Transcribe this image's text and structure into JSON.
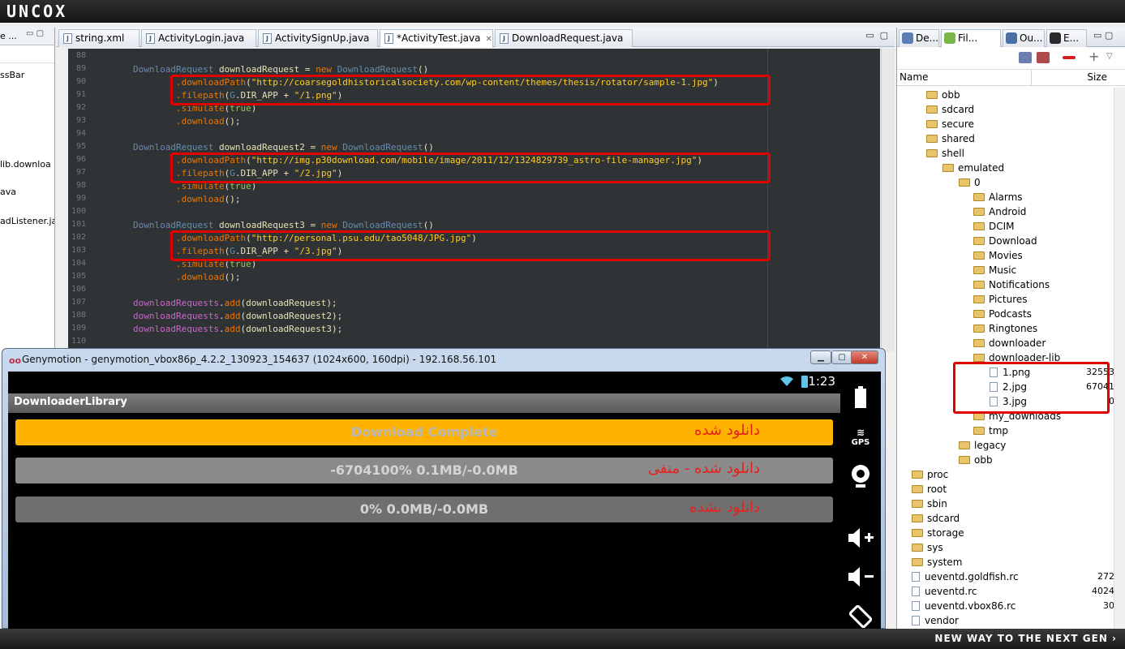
{
  "topbar": {
    "brand": "UNCOX"
  },
  "botbar": {
    "slogan": "NEW WAY TO THE NEXT GEN ›"
  },
  "left_panel": {
    "head_label": "e ...",
    "items": [
      "ssBar",
      "lib.downloa",
      "ava",
      "adListener.jav"
    ]
  },
  "editor": {
    "tabs": [
      {
        "label": "string.xml",
        "active": false
      },
      {
        "label": "ActivityLogin.java",
        "active": false
      },
      {
        "label": "ActivitySignUp.java",
        "active": false
      },
      {
        "label": "*ActivityTest.java",
        "active": true
      },
      {
        "label": "DownloadRequest.java",
        "active": false
      }
    ],
    "line_numbers": [
      "88",
      "89",
      "90",
      "91",
      "92",
      "93",
      "94",
      "95",
      "96",
      "97",
      "98",
      "99",
      "100",
      "101",
      "102",
      "103",
      "104",
      "105",
      "106",
      "107",
      "108",
      "109",
      "110"
    ],
    "lines": [
      [],
      [
        {
          "c": "ty",
          "t": "DownloadRequest"
        },
        {
          "c": "mt",
          "t": " downloadRequest = "
        },
        {
          "c": "st",
          "t": "new"
        },
        {
          "c": "mt",
          "t": " "
        },
        {
          "c": "ty",
          "t": "DownloadRequest"
        },
        {
          "c": "mt",
          "t": "()"
        }
      ],
      [
        {
          "c": "mt",
          "t": "        "
        },
        {
          "c": "st",
          "t": ".downloadPath"
        },
        {
          "c": "mt",
          "t": "("
        },
        {
          "c": "s2",
          "t": "\"http://coarsegoldhistoricalsociety.com/wp-content/themes/thesis/rotator/sample-1.jpg\""
        },
        {
          "c": "mt",
          "t": ")"
        }
      ],
      [
        {
          "c": "mt",
          "t": "        "
        },
        {
          "c": "st",
          "t": ".filepath"
        },
        {
          "c": "mt",
          "t": "("
        },
        {
          "c": "ty",
          "t": "G"
        },
        {
          "c": "mt",
          "t": ".DIR_APP + "
        },
        {
          "c": "s2",
          "t": "\"/1.png\""
        },
        {
          "c": "mt",
          "t": ")"
        }
      ],
      [
        {
          "c": "mt",
          "t": "        "
        },
        {
          "c": "st",
          "t": ".simulate"
        },
        {
          "c": "mt",
          "t": "("
        },
        {
          "c": "kw",
          "t": "true"
        },
        {
          "c": "mt",
          "t": ")"
        }
      ],
      [
        {
          "c": "mt",
          "t": "        "
        },
        {
          "c": "st",
          "t": ".download"
        },
        {
          "c": "mt",
          "t": "();"
        }
      ],
      [],
      [
        {
          "c": "ty",
          "t": "DownloadRequest"
        },
        {
          "c": "mt",
          "t": " downloadRequest2 = "
        },
        {
          "c": "st",
          "t": "new"
        },
        {
          "c": "mt",
          "t": " "
        },
        {
          "c": "ty",
          "t": "DownloadRequest"
        },
        {
          "c": "mt",
          "t": "()"
        }
      ],
      [
        {
          "c": "mt",
          "t": "        "
        },
        {
          "c": "st",
          "t": ".downloadPath"
        },
        {
          "c": "mt",
          "t": "("
        },
        {
          "c": "s2",
          "t": "\"http://img.p30download.com/mobile/image/2011/12/1324829739_astro-file-manager.jpg\""
        },
        {
          "c": "mt",
          "t": ")"
        }
      ],
      [
        {
          "c": "mt",
          "t": "        "
        },
        {
          "c": "st",
          "t": ".filepath"
        },
        {
          "c": "mt",
          "t": "("
        },
        {
          "c": "ty",
          "t": "G"
        },
        {
          "c": "mt",
          "t": ".DIR_APP + "
        },
        {
          "c": "s2",
          "t": "\"/2.jpg\""
        },
        {
          "c": "mt",
          "t": ")"
        }
      ],
      [
        {
          "c": "mt",
          "t": "        "
        },
        {
          "c": "st",
          "t": ".simulate"
        },
        {
          "c": "mt",
          "t": "("
        },
        {
          "c": "kw",
          "t": "true"
        },
        {
          "c": "mt",
          "t": ")"
        }
      ],
      [
        {
          "c": "mt",
          "t": "        "
        },
        {
          "c": "st",
          "t": ".download"
        },
        {
          "c": "mt",
          "t": "();"
        }
      ],
      [],
      [
        {
          "c": "ty",
          "t": "DownloadRequest"
        },
        {
          "c": "mt",
          "t": " downloadRequest3 = "
        },
        {
          "c": "st",
          "t": "new"
        },
        {
          "c": "mt",
          "t": " "
        },
        {
          "c": "ty",
          "t": "DownloadRequest"
        },
        {
          "c": "mt",
          "t": "()"
        }
      ],
      [
        {
          "c": "mt",
          "t": "        "
        },
        {
          "c": "st",
          "t": ".downloadPath"
        },
        {
          "c": "mt",
          "t": "("
        },
        {
          "c": "s2",
          "t": "\"http://personal.psu.edu/tao5048/JPG.jpg\""
        },
        {
          "c": "mt",
          "t": ")"
        }
      ],
      [
        {
          "c": "mt",
          "t": "        "
        },
        {
          "c": "st",
          "t": ".filepath"
        },
        {
          "c": "mt",
          "t": "("
        },
        {
          "c": "ty",
          "t": "G"
        },
        {
          "c": "mt",
          "t": ".DIR_APP + "
        },
        {
          "c": "s2",
          "t": "\"/3.jpg\""
        },
        {
          "c": "mt",
          "t": ")"
        }
      ],
      [
        {
          "c": "mt",
          "t": "        "
        },
        {
          "c": "st",
          "t": ".simulate"
        },
        {
          "c": "mt",
          "t": "("
        },
        {
          "c": "kw",
          "t": "true"
        },
        {
          "c": "mt",
          "t": ")"
        }
      ],
      [
        {
          "c": "mt",
          "t": "        "
        },
        {
          "c": "st",
          "t": ".download"
        },
        {
          "c": "mt",
          "t": "();"
        }
      ],
      [],
      [
        {
          "c": "fd",
          "t": "downloadRequests"
        },
        {
          "c": "mt",
          "t": "."
        },
        {
          "c": "st",
          "t": "add"
        },
        {
          "c": "mt",
          "t": "(downloadRequest);"
        }
      ],
      [
        {
          "c": "fd",
          "t": "downloadRequests"
        },
        {
          "c": "mt",
          "t": "."
        },
        {
          "c": "st",
          "t": "add"
        },
        {
          "c": "mt",
          "t": "(downloadRequest2);"
        }
      ],
      [
        {
          "c": "fd",
          "t": "downloadRequests"
        },
        {
          "c": "mt",
          "t": "."
        },
        {
          "c": "st",
          "t": "add"
        },
        {
          "c": "mt",
          "t": "(downloadRequest3);"
        }
      ],
      []
    ]
  },
  "right_panel": {
    "tabs": [
      {
        "label": "De...",
        "active": false
      },
      {
        "label": "Fil...",
        "active": true
      },
      {
        "label": "Ou...",
        "active": false
      },
      {
        "label": "E...",
        "active": false
      }
    ],
    "col_name": "Name",
    "col_size": "Size",
    "tree": [
      {
        "label": "obb",
        "type": "folder",
        "depth": 1,
        "size": ""
      },
      {
        "label": "sdcard",
        "type": "folder",
        "depth": 1,
        "size": ""
      },
      {
        "label": "secure",
        "type": "folder",
        "depth": 1,
        "size": ""
      },
      {
        "label": "shared",
        "type": "folder",
        "depth": 1,
        "size": ""
      },
      {
        "label": "shell",
        "type": "folder",
        "depth": 1,
        "size": ""
      },
      {
        "label": "emulated",
        "type": "folder",
        "depth": 2,
        "size": ""
      },
      {
        "label": "0",
        "type": "folder",
        "depth": 3,
        "size": ""
      },
      {
        "label": "Alarms",
        "type": "folder",
        "depth": 4,
        "size": ""
      },
      {
        "label": "Android",
        "type": "folder",
        "depth": 4,
        "size": ""
      },
      {
        "label": "DCIM",
        "type": "folder",
        "depth": 4,
        "size": ""
      },
      {
        "label": "Download",
        "type": "folder",
        "depth": 4,
        "size": ""
      },
      {
        "label": "Movies",
        "type": "folder",
        "depth": 4,
        "size": ""
      },
      {
        "label": "Music",
        "type": "folder",
        "depth": 4,
        "size": ""
      },
      {
        "label": "Notifications",
        "type": "folder",
        "depth": 4,
        "size": ""
      },
      {
        "label": "Pictures",
        "type": "folder",
        "depth": 4,
        "size": ""
      },
      {
        "label": "Podcasts",
        "type": "folder",
        "depth": 4,
        "size": ""
      },
      {
        "label": "Ringtones",
        "type": "folder",
        "depth": 4,
        "size": ""
      },
      {
        "label": "downloader",
        "type": "folder",
        "depth": 4,
        "size": ""
      },
      {
        "label": "downloader-lib",
        "type": "folder",
        "depth": 4,
        "size": ""
      },
      {
        "label": "1.png",
        "type": "file",
        "depth": 5,
        "size": "32553"
      },
      {
        "label": "2.jpg",
        "type": "file",
        "depth": 5,
        "size": "67041"
      },
      {
        "label": "3.jpg",
        "type": "file",
        "depth": 5,
        "size": "0"
      },
      {
        "label": "my_downloads",
        "type": "folder",
        "depth": 4,
        "size": ""
      },
      {
        "label": "tmp",
        "type": "folder",
        "depth": 4,
        "size": ""
      },
      {
        "label": "legacy",
        "type": "folder",
        "depth": 3,
        "size": ""
      },
      {
        "label": "obb",
        "type": "folder",
        "depth": 3,
        "size": ""
      },
      {
        "label": "proc",
        "type": "folder",
        "depth": 0,
        "size": ""
      },
      {
        "label": "root",
        "type": "folder",
        "depth": 0,
        "size": ""
      },
      {
        "label": "sbin",
        "type": "folder",
        "depth": 0,
        "size": ""
      },
      {
        "label": "sdcard",
        "type": "folder",
        "depth": 0,
        "size": ""
      },
      {
        "label": "storage",
        "type": "folder",
        "depth": 0,
        "size": ""
      },
      {
        "label": "sys",
        "type": "folder",
        "depth": 0,
        "size": ""
      },
      {
        "label": "system",
        "type": "folder",
        "depth": 0,
        "size": ""
      },
      {
        "label": "ueventd.goldfish.rc",
        "type": "file",
        "depth": 0,
        "size": "272"
      },
      {
        "label": "ueventd.rc",
        "type": "file",
        "depth": 0,
        "size": "4024"
      },
      {
        "label": "ueventd.vbox86.rc",
        "type": "file",
        "depth": 0,
        "size": "30"
      },
      {
        "label": "vendor",
        "type": "file",
        "depth": 0,
        "size": ""
      }
    ]
  },
  "emulator": {
    "logo": "oo",
    "title": "Genymotion - genymotion_vbox86p_4.2.2_130923_154637 (1024x600, 160dpi) - 192.168.56.101",
    "clock": "1:23",
    "app_title": "DownloaderLibrary",
    "progress": [
      {
        "label": "Download Complete",
        "fa": "دانلود شده",
        "percent": 100,
        "color": "#ffb300",
        "text_color": "#b7b7b7"
      },
      {
        "label": "-6704100% 0.1MB/-0.0MB",
        "fa": "دانلود شده - منفی",
        "percent": 100,
        "color": "#8a8a8a",
        "text_color": "#d4d4d4"
      },
      {
        "label": "0% 0.0MB/-0.0MB",
        "fa": "دانلود نشده",
        "percent": 0,
        "color": "#8a8a8a",
        "text_color": "#d4d4d4"
      }
    ],
    "sidebar": {
      "gps_label": "GPS"
    }
  },
  "colors": {
    "highlight_border": "#e00000",
    "code_bg": "#2f3335"
  }
}
